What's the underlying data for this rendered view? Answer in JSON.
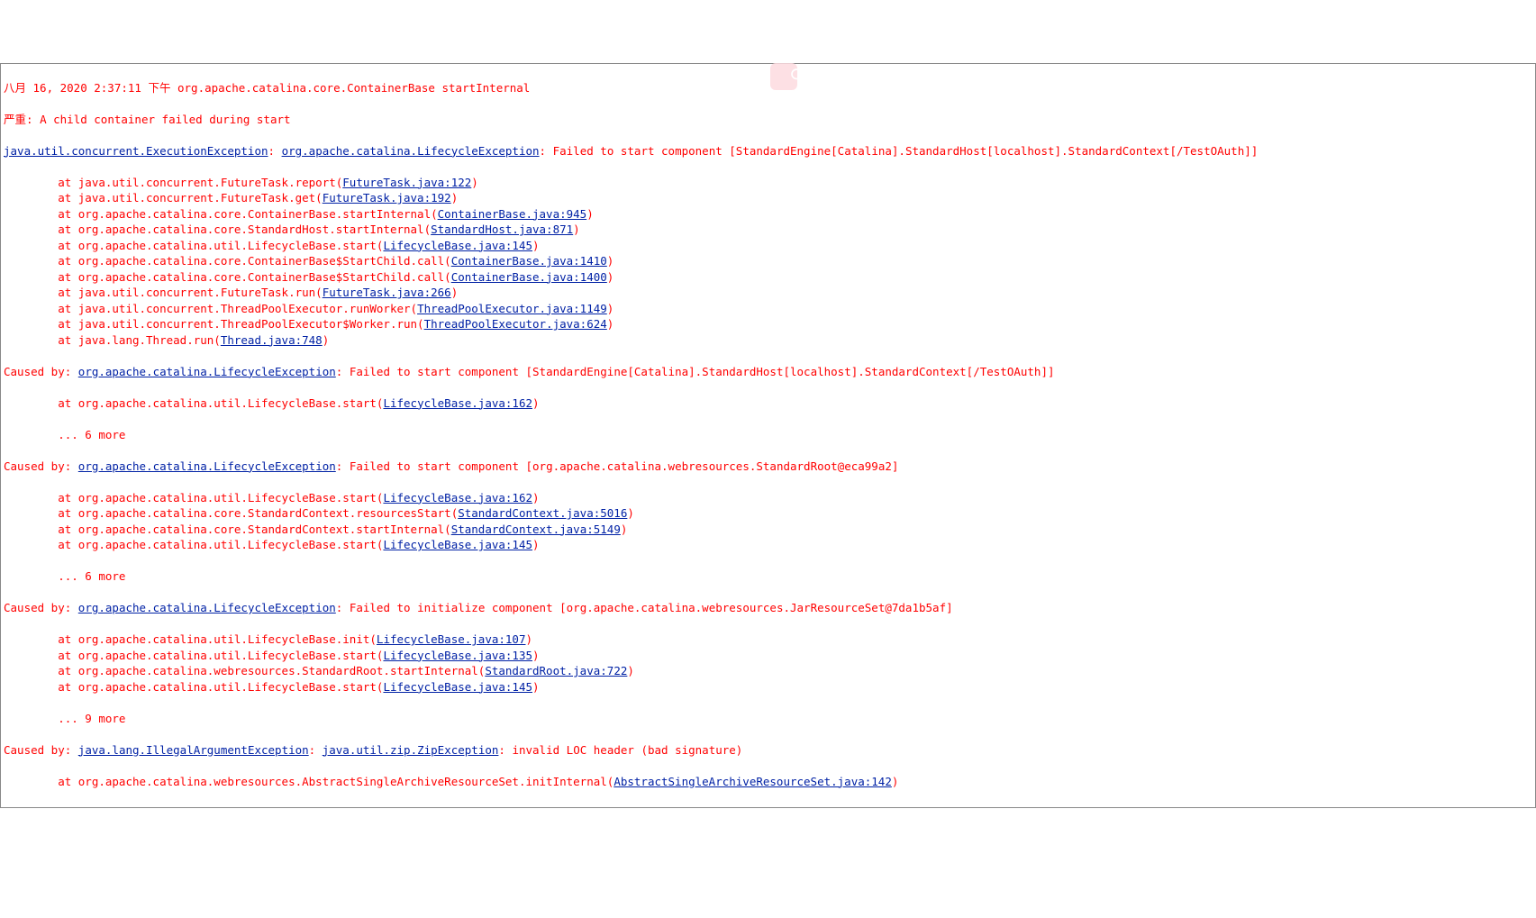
{
  "timestamp_line": "八月 16, 2020 2:37:11 下午 org.apache.catalina.core.ContainerBase startInternal",
  "severity_label": "严重",
  "severity_msg": "A child container failed during start",
  "top": {
    "exc": "java.util.concurrent.ExecutionException",
    "sep1": ": ",
    "cause": "org.apache.catalina.LifecycleException",
    "sep2": ": ",
    "msg": "Failed to start component [StandardEngine[Catalina].StandardHost[localhost].StandardContext[/TestOAuth]]"
  },
  "stack1": [
    {
      "pre": "at java.util.concurrent.FutureTask.report(",
      "link": "FutureTask.java:122",
      "post": ")"
    },
    {
      "pre": "at java.util.concurrent.FutureTask.get(",
      "link": "FutureTask.java:192",
      "post": ")"
    },
    {
      "pre": "at org.apache.catalina.core.ContainerBase.startInternal(",
      "link": "ContainerBase.java:945",
      "post": ")"
    },
    {
      "pre": "at org.apache.catalina.core.StandardHost.startInternal(",
      "link": "StandardHost.java:871",
      "post": ")"
    },
    {
      "pre": "at org.apache.catalina.util.LifecycleBase.start(",
      "link": "LifecycleBase.java:145",
      "post": ")"
    },
    {
      "pre": "at org.apache.catalina.core.ContainerBase$StartChild.call(",
      "link": "ContainerBase.java:1410",
      "post": ")"
    },
    {
      "pre": "at org.apache.catalina.core.ContainerBase$StartChild.call(",
      "link": "ContainerBase.java:1400",
      "post": ")"
    },
    {
      "pre": "at java.util.concurrent.FutureTask.run(",
      "link": "FutureTask.java:266",
      "post": ")"
    },
    {
      "pre": "at java.util.concurrent.ThreadPoolExecutor.runWorker(",
      "link": "ThreadPoolExecutor.java:1149",
      "post": ")"
    },
    {
      "pre": "at java.util.concurrent.ThreadPoolExecutor$Worker.run(",
      "link": "ThreadPoolExecutor.java:624",
      "post": ")"
    },
    {
      "pre": "at java.lang.Thread.run(",
      "link": "Thread.java:748",
      "post": ")"
    }
  ],
  "cause1": {
    "label": "Caused by: ",
    "exc": "org.apache.catalina.LifecycleException",
    "msg": ": Failed to start component [StandardEngine[Catalina].StandardHost[localhost].StandardContext[/TestOAuth]]"
  },
  "stack2": [
    {
      "pre": "at org.apache.catalina.util.LifecycleBase.start(",
      "link": "LifecycleBase.java:162",
      "post": ")"
    }
  ],
  "more1": "... 6 more",
  "cause2": {
    "label": "Caused by: ",
    "exc": "org.apache.catalina.LifecycleException",
    "msg": ": Failed to start component [org.apache.catalina.webresources.StandardRoot@eca99a2]"
  },
  "stack3": [
    {
      "pre": "at org.apache.catalina.util.LifecycleBase.start(",
      "link": "LifecycleBase.java:162",
      "post": ")"
    },
    {
      "pre": "at org.apache.catalina.core.StandardContext.resourcesStart(",
      "link": "StandardContext.java:5016",
      "post": ")"
    },
    {
      "pre": "at org.apache.catalina.core.StandardContext.startInternal(",
      "link": "StandardContext.java:5149",
      "post": ")"
    },
    {
      "pre": "at org.apache.catalina.util.LifecycleBase.start(",
      "link": "LifecycleBase.java:145",
      "post": ")"
    }
  ],
  "more2": "... 6 more",
  "cause3": {
    "label": "Caused by: ",
    "exc": "org.apache.catalina.LifecycleException",
    "msg": ": Failed to initialize component [org.apache.catalina.webresources.JarResourceSet@7da1b5af]"
  },
  "stack4": [
    {
      "pre": "at org.apache.catalina.util.LifecycleBase.init(",
      "link": "LifecycleBase.java:107",
      "post": ")"
    },
    {
      "pre": "at org.apache.catalina.util.LifecycleBase.start(",
      "link": "LifecycleBase.java:135",
      "post": ")"
    },
    {
      "pre": "at org.apache.catalina.webresources.StandardRoot.startInternal(",
      "link": "StandardRoot.java:722",
      "post": ")"
    },
    {
      "pre": "at org.apache.catalina.util.LifecycleBase.start(",
      "link": "LifecycleBase.java:145",
      "post": ")"
    }
  ],
  "more3": "... 9 more",
  "cause4": {
    "label": "Caused by: ",
    "exc": "java.lang.IllegalArgumentException",
    "sep": ": ",
    "cause2": "java.util.zip.ZipException",
    "msg": ": invalid LOC header (bad signature)"
  },
  "stack5": [
    {
      "pre": "at org.apache.catalina.webresources.AbstractSingleArchiveResourceSet.initInternal(",
      "link": "AbstractSingleArchiveResourceSet.java:142",
      "post": ")"
    }
  ]
}
